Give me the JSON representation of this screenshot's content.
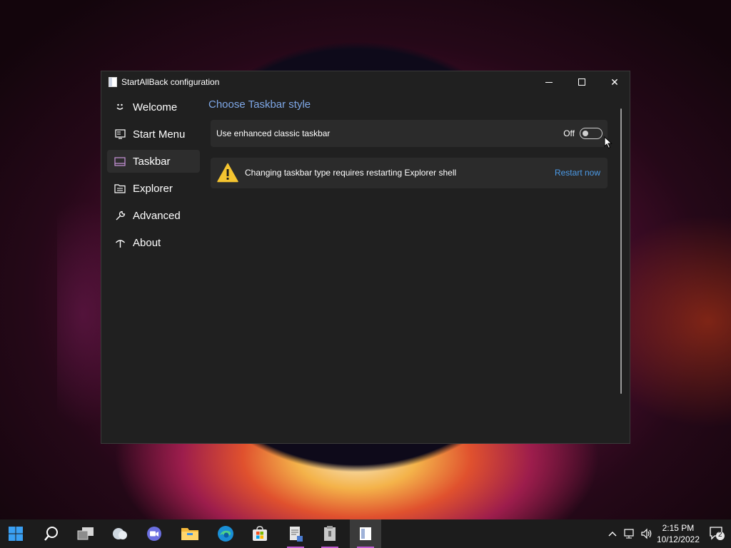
{
  "window": {
    "title": "StartAllBack configuration",
    "minimize": "—",
    "maximize": "☐",
    "close": "✕"
  },
  "sidebar": {
    "items": [
      {
        "label": "Welcome",
        "icon": "smiley-icon",
        "active": false
      },
      {
        "label": "Start Menu",
        "icon": "start-menu-icon",
        "active": false
      },
      {
        "label": "Taskbar",
        "icon": "taskbar-icon",
        "active": true
      },
      {
        "label": "Explorer",
        "icon": "explorer-icon",
        "active": false
      },
      {
        "label": "Advanced",
        "icon": "wrench-icon",
        "active": false
      },
      {
        "label": "About",
        "icon": "about-icon",
        "active": false
      }
    ]
  },
  "main": {
    "section_title": "Choose Taskbar style",
    "toggle_card": {
      "label": "Use enhanced classic taskbar",
      "state_text": "Off",
      "checked": false
    },
    "warning_card": {
      "icon": "warning-icon",
      "text": "Changing taskbar type requires restarting Explorer shell",
      "link": "Restart now"
    }
  },
  "taskbar": {
    "items": [
      {
        "name": "start-button",
        "icon": "windows-logo-icon"
      },
      {
        "name": "search-button",
        "icon": "search-icon"
      },
      {
        "name": "task-view-button",
        "icon": "task-view-icon"
      },
      {
        "name": "weather-button",
        "icon": "cloud-icon"
      },
      {
        "name": "teams-chat-button",
        "icon": "video-chat-icon"
      },
      {
        "name": "file-explorer-button",
        "icon": "folder-icon"
      },
      {
        "name": "edge-button",
        "icon": "edge-icon"
      },
      {
        "name": "store-button",
        "icon": "store-icon"
      },
      {
        "name": "notepad-app-button",
        "icon": "document-icon"
      },
      {
        "name": "archive-app-button",
        "icon": "archive-icon"
      },
      {
        "name": "startallback-app-button",
        "icon": "startallback-icon"
      }
    ],
    "tray": {
      "time": "2:15 PM",
      "date": "10/12/2022",
      "notification_count": "2"
    }
  },
  "colors": {
    "accent": "#7ea7e6",
    "link": "#4c9be8",
    "window_bg": "#202020",
    "card_bg": "#2b2b2b",
    "taskbar_bg": "#1c1c1c"
  }
}
